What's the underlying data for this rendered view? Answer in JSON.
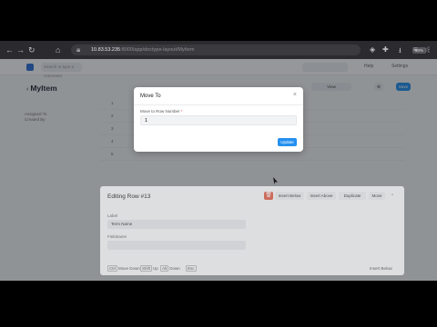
{
  "browser": {
    "url_host": "10.83.53.235",
    "url_path": ":8000/app/doctype-layout/MyItem",
    "zoom_badge": "80%"
  },
  "app": {
    "search_placeholder": "Search or type a command",
    "nav_links": [
      "Help",
      "Settings"
    ],
    "page_title": "MyItem",
    "back_glyph": "‹",
    "sidebar_links": [
      "Assigned To",
      "Created By"
    ],
    "top_buttons": {
      "view": "View",
      "save": "Save"
    },
    "list_rows": [
      {
        "idx": "1",
        "name": "",
        "value": "",
        "col4": ""
      },
      {
        "idx": "2",
        "name": "",
        "value": "",
        "col4": ""
      },
      {
        "idx": "3",
        "name": "",
        "value": "",
        "col4": ""
      },
      {
        "idx": "4",
        "name": "",
        "value": "",
        "col4": ""
      },
      {
        "idx": "5",
        "name": "",
        "value": "",
        "col4": ""
      }
    ],
    "list_rows_bottom": [
      {
        "idx": "",
        "name": "",
        "value": "",
        "col4": ""
      },
      {
        "idx": "",
        "name": "",
        "value": "",
        "col4": ""
      }
    ]
  },
  "edit_panel": {
    "title": "Editing Row #13",
    "buttons": [
      "Insert Below",
      "Insert Above",
      "Duplicate",
      "Move"
    ],
    "delete_glyph": "🗑",
    "collapse_glyph": "⌃",
    "field1_label": "Label",
    "field1_value": "Term Name",
    "field2_label": "Fieldname",
    "field2_value": "",
    "footer_keys": [
      {
        "key": "Ctrl",
        "text": "Move Down"
      },
      {
        "key": "Shift",
        "text": "Up"
      },
      {
        "key": "Alt",
        "text": "Down"
      },
      {
        "key": "Esc",
        "text": ""
      }
    ],
    "footer_right": "Insert Below"
  },
  "modal": {
    "title": "Move To",
    "close_glyph": "×",
    "field_label": "Move to Row Number",
    "required_mark": "*",
    "field_value": "1",
    "submit_label": "Update"
  },
  "colors": {
    "primary": "#2490ef",
    "danger": "#e0604a"
  }
}
